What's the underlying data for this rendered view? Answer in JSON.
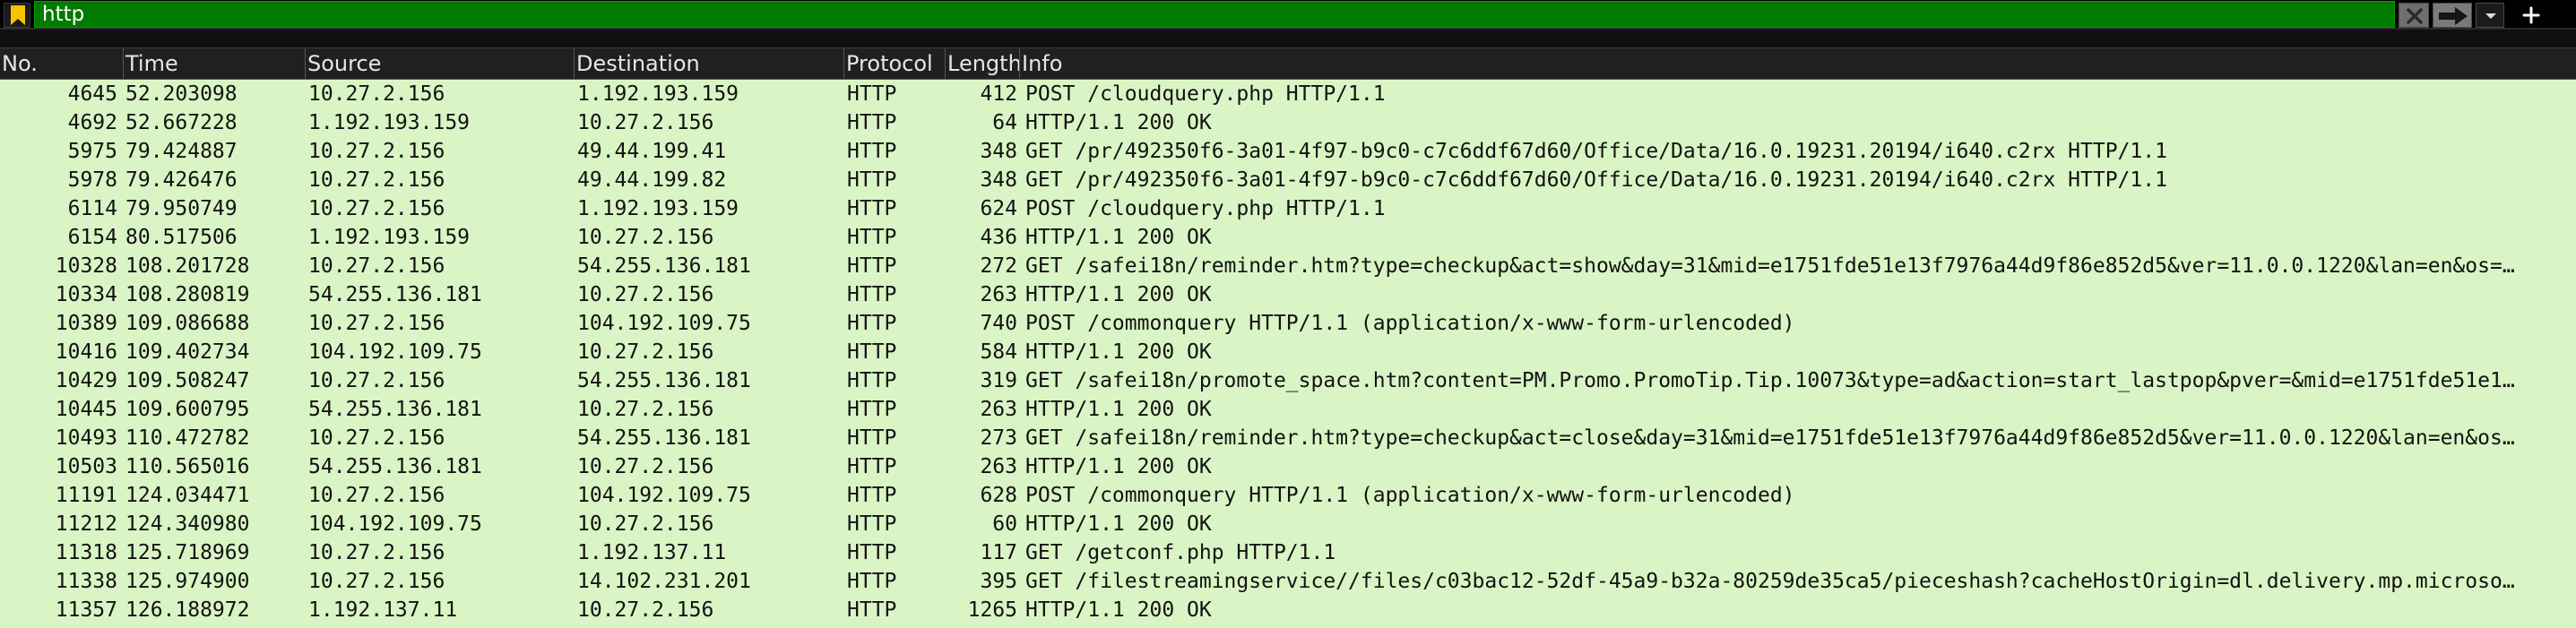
{
  "filter": {
    "value": "http",
    "bookmark_icon": "bookmark-icon",
    "clear_icon": "clear-x-icon",
    "apply_icon": "arrow-right-icon",
    "dropdown_icon": "chevron-down-icon",
    "add_icon": "plus-icon",
    "colors": {
      "valid_bg": "#007a00",
      "bar_bg": "#000000",
      "bookmark": "#f5c400"
    }
  },
  "columns": [
    "No.",
    "Time",
    "Source",
    "Destination",
    "Protocol",
    "Length",
    "Info"
  ],
  "row_color": "#daf5c5",
  "packets": [
    {
      "no": "4645",
      "time": "52.203098",
      "src": "10.27.2.156",
      "dst": "1.192.193.159",
      "proto": "HTTP",
      "len": "412",
      "info": "POST /cloudquery.php HTTP/1.1"
    },
    {
      "no": "4692",
      "time": "52.667228",
      "src": "1.192.193.159",
      "dst": "10.27.2.156",
      "proto": "HTTP",
      "len": "64",
      "info": "HTTP/1.1 200 OK"
    },
    {
      "no": "5975",
      "time": "79.424887",
      "src": "10.27.2.156",
      "dst": "49.44.199.41",
      "proto": "HTTP",
      "len": "348",
      "info": "GET /pr/492350f6-3a01-4f97-b9c0-c7c6ddf67d60/Office/Data/16.0.19231.20194/i640.c2rx HTTP/1.1"
    },
    {
      "no": "5978",
      "time": "79.426476",
      "src": "10.27.2.156",
      "dst": "49.44.199.82",
      "proto": "HTTP",
      "len": "348",
      "info": "GET /pr/492350f6-3a01-4f97-b9c0-c7c6ddf67d60/Office/Data/16.0.19231.20194/i640.c2rx HTTP/1.1"
    },
    {
      "no": "6114",
      "time": "79.950749",
      "src": "10.27.2.156",
      "dst": "1.192.193.159",
      "proto": "HTTP",
      "len": "624",
      "info": "POST /cloudquery.php HTTP/1.1"
    },
    {
      "no": "6154",
      "time": "80.517506",
      "src": "1.192.193.159",
      "dst": "10.27.2.156",
      "proto": "HTTP",
      "len": "436",
      "info": "HTTP/1.1 200 OK"
    },
    {
      "no": "10328",
      "time": "108.201728",
      "src": "10.27.2.156",
      "dst": "54.255.136.181",
      "proto": "HTTP",
      "len": "272",
      "info": "GET /safei18n/reminder.htm?type=checkup&act=show&day=31&mid=e1751fde51e13f7976a44d9f86e852d5&ver=11.0.0.1220&lan=en&os=…"
    },
    {
      "no": "10334",
      "time": "108.280819",
      "src": "54.255.136.181",
      "dst": "10.27.2.156",
      "proto": "HTTP",
      "len": "263",
      "info": "HTTP/1.1 200 OK"
    },
    {
      "no": "10389",
      "time": "109.086688",
      "src": "10.27.2.156",
      "dst": "104.192.109.75",
      "proto": "HTTP",
      "len": "740",
      "info": "POST /commonquery HTTP/1.1  (application/x-www-form-urlencoded)"
    },
    {
      "no": "10416",
      "time": "109.402734",
      "src": "104.192.109.75",
      "dst": "10.27.2.156",
      "proto": "HTTP",
      "len": "584",
      "info": "HTTP/1.1 200 OK"
    },
    {
      "no": "10429",
      "time": "109.508247",
      "src": "10.27.2.156",
      "dst": "54.255.136.181",
      "proto": "HTTP",
      "len": "319",
      "info": "GET /safei18n/promote_space.htm?content=PM.Promo.PromoTip.Tip.10073&type=ad&action=start_lastpop&pver=&mid=e1751fde51e1…"
    },
    {
      "no": "10445",
      "time": "109.600795",
      "src": "54.255.136.181",
      "dst": "10.27.2.156",
      "proto": "HTTP",
      "len": "263",
      "info": "HTTP/1.1 200 OK"
    },
    {
      "no": "10493",
      "time": "110.472782",
      "src": "10.27.2.156",
      "dst": "54.255.136.181",
      "proto": "HTTP",
      "len": "273",
      "info": "GET /safei18n/reminder.htm?type=checkup&act=close&day=31&mid=e1751fde51e13f7976a44d9f86e852d5&ver=11.0.0.1220&lan=en&os…"
    },
    {
      "no": "10503",
      "time": "110.565016",
      "src": "54.255.136.181",
      "dst": "10.27.2.156",
      "proto": "HTTP",
      "len": "263",
      "info": "HTTP/1.1 200 OK"
    },
    {
      "no": "11191",
      "time": "124.034471",
      "src": "10.27.2.156",
      "dst": "104.192.109.75",
      "proto": "HTTP",
      "len": "628",
      "info": "POST /commonquery HTTP/1.1  (application/x-www-form-urlencoded)"
    },
    {
      "no": "11212",
      "time": "124.340980",
      "src": "104.192.109.75",
      "dst": "10.27.2.156",
      "proto": "HTTP",
      "len": "60",
      "info": "HTTP/1.1 200 OK"
    },
    {
      "no": "11318",
      "time": "125.718969",
      "src": "10.27.2.156",
      "dst": "1.192.137.11",
      "proto": "HTTP",
      "len": "117",
      "info": "GET /getconf.php HTTP/1.1"
    },
    {
      "no": "11338",
      "time": "125.974900",
      "src": "10.27.2.156",
      "dst": "14.102.231.201",
      "proto": "HTTP",
      "len": "395",
      "info": "GET /filestreamingservice//files/c03bac12-52df-45a9-b32a-80259de35ca5/pieceshash?cacheHostOrigin=dl.delivery.mp.microso…"
    },
    {
      "no": "11357",
      "time": "126.188972",
      "src": "1.192.137.11",
      "dst": "10.27.2.156",
      "proto": "HTTP",
      "len": "1265",
      "info": "HTTP/1.1 200 OK"
    }
  ]
}
